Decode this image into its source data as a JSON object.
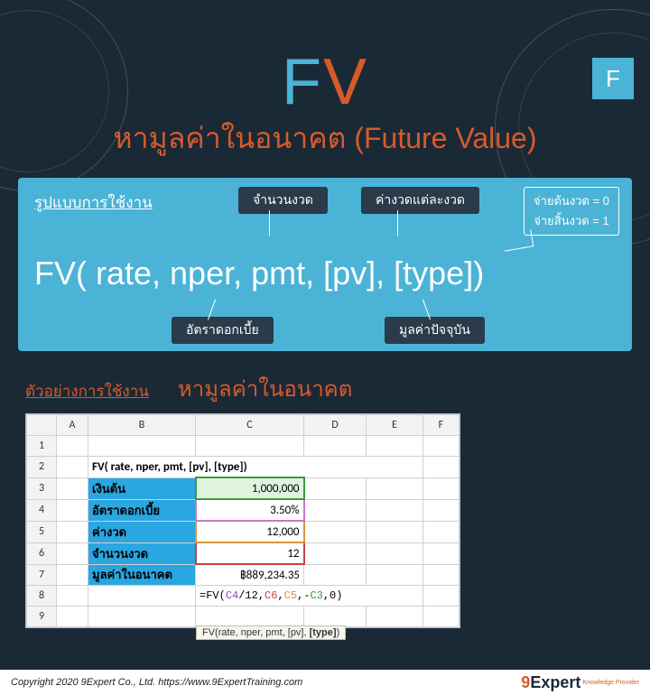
{
  "badge": "F",
  "title": {
    "letter_f": "F",
    "letter_v": "V"
  },
  "subtitle": "หามูลค่าในอนาคต (Future Value)",
  "syntax": {
    "usage_label": "รูปแบบการใช้งาน",
    "formula": "FV( rate, nper, pmt, [pv], [type])",
    "tags": {
      "nper": "จำนวนงวด",
      "pmt": "ค่างวดแต่ละงวด",
      "rate": "อัตราดอกเบี้ย",
      "pv": "มูลค่าปัจจุบัน"
    },
    "type_begin": "จ่ายต้นงวด = 0",
    "type_end": "จ่ายสิ้นงวด = 1"
  },
  "example": {
    "label": "ตัวอย่างการใช้งาน",
    "title": "หามูลค่าในอนาคต"
  },
  "sheet": {
    "cols": [
      "",
      "A",
      "B",
      "C",
      "D",
      "E",
      "F"
    ],
    "row1": "",
    "row2": "FV( rate, nper, pmt, [pv], [type])",
    "rows": [
      {
        "label": "เงินต้น",
        "value": "1,000,000"
      },
      {
        "label": "อัตราดอกเบี้ย",
        "value": "3.50%"
      },
      {
        "label": "ค่างวด",
        "value": "12,000"
      },
      {
        "label": "จำนวนงวด",
        "value": "12"
      },
      {
        "label": "มูลค่าในอนาคต",
        "value": "฿889,234.35"
      }
    ],
    "formula_parts": {
      "prefix": "=FV(",
      "c4": "C4",
      "div": "/12,",
      "c6": "C6",
      "com1": ",",
      "c5": "C5",
      "com2": ",-",
      "c3": "C3",
      "suffix": ",0)"
    },
    "tooltip_plain": "FV(rate, nper, pmt, [pv], ",
    "tooltip_bold": "[type]",
    "tooltip_close": ")"
  },
  "footer": {
    "copyright": "Copyright 2020 9Expert Co., Ltd.   https://www.9ExpertTraining.com",
    "logo_nine": "9",
    "logo_text": "Expert",
    "logo_sub": "Knowledge Provider"
  }
}
